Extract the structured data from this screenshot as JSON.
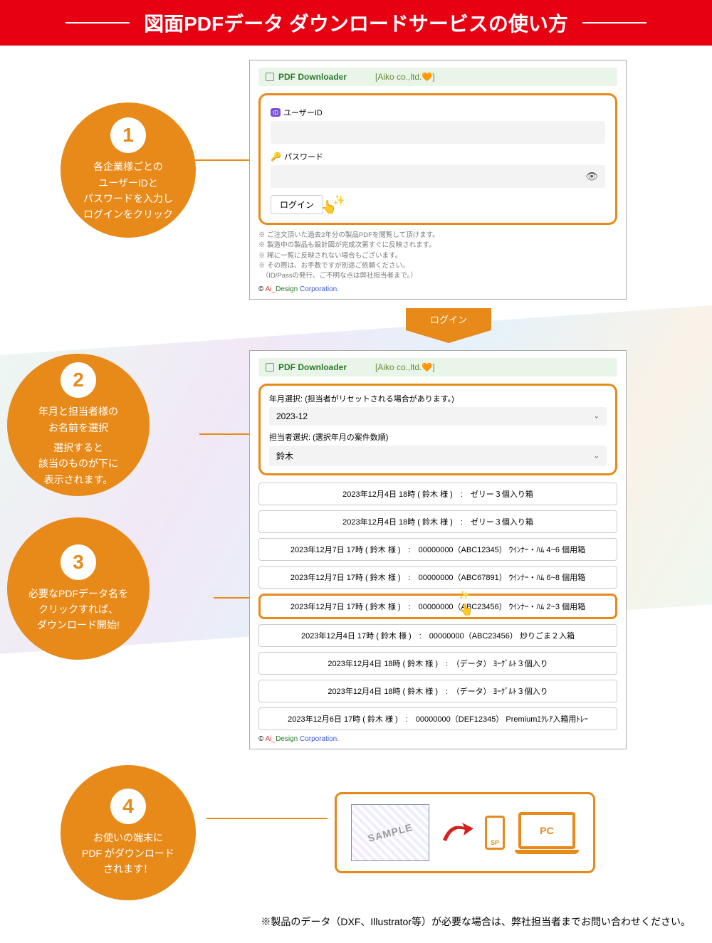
{
  "hero": {
    "title": "図面PDFデータ ダウンロードサービスの使い方"
  },
  "app": {
    "title": "PDF Downloader",
    "company": "[Aiko co.,ltd.🧡]"
  },
  "step1": {
    "num": "1",
    "text": "各企業様ごとの\nユーザーIDと\nパスワードを入力し\nログインをクリック",
    "user_label": "ユーザーID",
    "id_badge": "ID",
    "pass_label": "パスワード",
    "login_btn": "ログイン",
    "notes": [
      "※ ご注文頂いた過去2年分の製品PDFを閲覧して頂けます。",
      "※ 製造中の製品も設計図が完成次第すぐに反映されます。",
      "※ 稀に一覧に反映されない場合もございます。",
      "※ その際は、お手数ですが別途ご依頼ください。",
      "　（ID/Passの発行、ご不明な点は弊社担当者まで。）"
    ],
    "copyright_c": "©",
    "copyright_ai": "Ai_",
    "copyright_design": "Design ",
    "copyright_corp": "Corporation."
  },
  "login_arrow": "ログイン",
  "step2": {
    "num": "2",
    "text1": "年月と担当者様の\nお名前を選択",
    "text2": "選択すると\n該当のものが下に\n表示されます。",
    "ym_label": "年月選択: (担当者がリセットされる場合があります。)",
    "ym_value": "2023-12",
    "person_label": "担当者選択: (選択年月の案件数順)",
    "person_value": "鈴木"
  },
  "step3": {
    "num": "3",
    "text": "必要なPDFデータ名を\nクリックすれば、\nダウンロード開始!"
  },
  "list": [
    "2023年12月4日 18時 ( 鈴木 様 )　:　ゼリー３個入り箱",
    "2023年12月4日 18時 ( 鈴木 様 )　:　ゼリー３個入り箱",
    "2023年12月7日 17時 ( 鈴木 様 )　:　00000000（ABC12345） ｳｲﾝﾅｰ・ﾊﾑ 4~6 個用箱",
    "2023年12月7日 17時 ( 鈴木 様 )　:　00000000（ABC67891） ｳｲﾝﾅｰ・ﾊﾑ 6~8 個用箱",
    "2023年12月7日 17時 ( 鈴木 様 )　:　00000000（ABC23456） ｳｲﾝﾅｰ・ﾊﾑ 2~3 個用箱",
    "2023年12月4日 17時 ( 鈴木 様 )　:　00000000（ABC23456） 炒りごま２入箱",
    "2023年12月4日 18時 ( 鈴木 様 )　:　（データ） ﾖｰｸﾞﾙﾄ３個入り",
    "2023年12月4日 18時 ( 鈴木 様 )　:　（データ） ﾖｰｸﾞﾙﾄ３個入り",
    "2023年12月6日 17時 ( 鈴木 様 )　:　00000000（DEF12345） Premiumｴｸﾚｱ入箱用ﾄﾚｰ"
  ],
  "step4": {
    "num": "4",
    "text": "お使いの端末に\nPDF がダウンロード\nされます！",
    "sample": "SAMPLE",
    "sp": "SP",
    "pc": "PC"
  },
  "footnote": "※製品のデータ（DXF、Illustrator等）が必要な場合は、弊社担当者までお問い合わせください。"
}
